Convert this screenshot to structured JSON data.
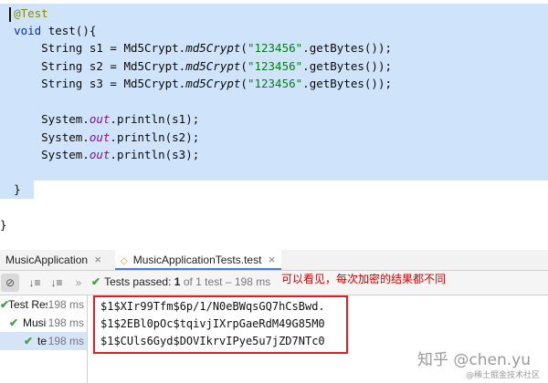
{
  "editor": {
    "lines": [
      {
        "indent": "  ",
        "annotation": "@Test"
      },
      {
        "indent": "  ",
        "kw": "void",
        "rest": " test(){"
      },
      {
        "indent": "      ",
        "pre": "String s1 = Md5Crypt.",
        "method": "md5Crypt",
        "open": "(",
        "str": "\"123456\"",
        "post": ".getBytes());"
      },
      {
        "indent": "      ",
        "pre": "String s2 = Md5Crypt.",
        "method": "md5Crypt",
        "open": "(",
        "str": "\"123456\"",
        "post": ".getBytes());"
      },
      {
        "indent": "      ",
        "pre": "String s3 = Md5Crypt.",
        "method": "md5Crypt",
        "open": "(",
        "str": "\"123456\"",
        "post": ".getBytes());"
      },
      {
        "indent": "",
        "text": ""
      },
      {
        "indent": "      ",
        "pre": "System.",
        "field": "out",
        "post": ".println(s1);"
      },
      {
        "indent": "      ",
        "pre": "System.",
        "field": "out",
        "post": ".println(s2);"
      },
      {
        "indent": "      ",
        "pre": "System.",
        "field": "out",
        "post": ".println(s3);"
      },
      {
        "indent": "",
        "text": ""
      },
      {
        "indent": "  ",
        "text": "}"
      },
      {
        "indent": "",
        "text": ""
      },
      {
        "indent": "",
        "text": "}"
      }
    ]
  },
  "tabs": [
    {
      "label": "MusicApplication",
      "close": "×",
      "active": false
    },
    {
      "label": "MusicApplicationTests.test",
      "close": "×",
      "active": true
    }
  ],
  "toolbar": {
    "status_check": "✔",
    "status_label": "Tests passed:",
    "status_count": "1",
    "status_rest": "of 1 test – 198 ms",
    "annotation_note": "可以看见，每次加密的结果都不同"
  },
  "test_tree": [
    {
      "name": "Test Res",
      "time": "198 ms",
      "check": false,
      "selected": false
    },
    {
      "name": "Musi",
      "time": "198 ms",
      "check": true,
      "selected": false
    },
    {
      "name": "te",
      "time": "198 ms",
      "check": true,
      "selected": true
    }
  ],
  "console_output": [
    "$1$XIr99Tfm$6p/1/N0eBWqsGQ7hCsBwd.",
    "$1$2EBl0pOc$tqivjIXrpGaeRdM49G85M0",
    "$1$CUls6Gyd$DOVIkrvIPye5u7jZD7NTc0"
  ],
  "watermark": {
    "brand": "知乎",
    "handle": "@chen.yu",
    "source": "@稀土掘金技术社区"
  },
  "colors": {
    "selection": "#cfe3fb",
    "keyword": "#0033b3",
    "string": "#067d17",
    "annotation": "#8a8a00",
    "static_field": "#871094",
    "pass_green": "#3fa33f",
    "highlight_red": "#e02020"
  }
}
